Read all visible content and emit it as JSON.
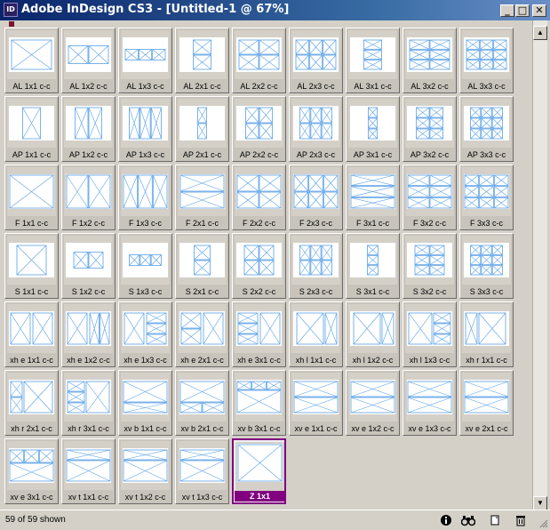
{
  "window": {
    "title": "Adobe InDesign CS3 - [Untitled-1 @ 67%]",
    "app_icon_text": "ID",
    "minimize": "_",
    "maximize": "□",
    "close": "✕"
  },
  "library": {
    "items": [
      {
        "label": "AL 1x1 c-c",
        "kind": "L1x1"
      },
      {
        "label": "AL 1x2 c-c",
        "kind": "L1x2"
      },
      {
        "label": "AL 1x3 c-c",
        "kind": "L1x3"
      },
      {
        "label": "AL 2x1 c-c",
        "kind": "L2x1"
      },
      {
        "label": "AL 2x2 c-c",
        "kind": "L2x2"
      },
      {
        "label": "AL 2x3 c-c",
        "kind": "L2x3"
      },
      {
        "label": "AL 3x1 c-c",
        "kind": "L3x1"
      },
      {
        "label": "AL 3x2 c-c",
        "kind": "L3x2"
      },
      {
        "label": "AL 3x3 c-c",
        "kind": "L3x3"
      },
      {
        "label": "AP 1x1 c-c",
        "kind": "P1x1"
      },
      {
        "label": "AP 1x2 c-c",
        "kind": "P1x2"
      },
      {
        "label": "AP 1x3 c-c",
        "kind": "P1x3"
      },
      {
        "label": "AP 2x1 c-c",
        "kind": "P2x1"
      },
      {
        "label": "AP 2x2 c-c",
        "kind": "P2x2"
      },
      {
        "label": "AP 2x3 c-c",
        "kind": "P2x3"
      },
      {
        "label": "AP 3x1 c-c",
        "kind": "P3x1"
      },
      {
        "label": "AP 3x2 c-c",
        "kind": "P3x2"
      },
      {
        "label": "AP 3x3 c-c",
        "kind": "P3x3"
      },
      {
        "label": "F 1x1 c-c",
        "kind": "F1x1"
      },
      {
        "label": "F 1x2 c-c",
        "kind": "F1x2"
      },
      {
        "label": "F 1x3 c-c",
        "kind": "F1x3"
      },
      {
        "label": "F 2x1 c-c",
        "kind": "F2x1"
      },
      {
        "label": "F 2x2 c-c",
        "kind": "F2x2"
      },
      {
        "label": "F 2x3 c-c",
        "kind": "F2x3"
      },
      {
        "label": "F 3x1 c-c",
        "kind": "F3x1"
      },
      {
        "label": "F 3x2 c-c",
        "kind": "F3x2"
      },
      {
        "label": "F 3x3 c-c",
        "kind": "F3x3"
      },
      {
        "label": "S 1x1 c-c",
        "kind": "S1x1"
      },
      {
        "label": "S 1x2 c-c",
        "kind": "S1x2"
      },
      {
        "label": "S 1x3 c-c",
        "kind": "S1x3"
      },
      {
        "label": "S 2x1 c-c",
        "kind": "S2x1"
      },
      {
        "label": "S 2x2 c-c",
        "kind": "S2x2"
      },
      {
        "label": "S 2x3 c-c",
        "kind": "S2x3"
      },
      {
        "label": "S 3x1 c-c",
        "kind": "S3x1"
      },
      {
        "label": "S 3x2 c-c",
        "kind": "S3x2"
      },
      {
        "label": "S 3x3 c-c",
        "kind": "S3x3"
      },
      {
        "label": "xh e 1x1 c-c",
        "kind": "XE11"
      },
      {
        "label": "xh e 1x2 c-c",
        "kind": "XE12"
      },
      {
        "label": "xh e 1x3 c-c",
        "kind": "XE13"
      },
      {
        "label": "xh e 2x1 c-c",
        "kind": "XE21"
      },
      {
        "label": "xh e 3x1 c-c",
        "kind": "XE31"
      },
      {
        "label": "xh l 1x1 c-c",
        "kind": "XL11"
      },
      {
        "label": "xh l 1x2 c-c",
        "kind": "XL12"
      },
      {
        "label": "xh l 1x3 c-c",
        "kind": "XL13"
      },
      {
        "label": "xh r 1x1 c-c",
        "kind": "XR11"
      },
      {
        "label": "xh r 2x1 c-c",
        "kind": "XR21"
      },
      {
        "label": "xh r 3x1 c-c",
        "kind": "XR31"
      },
      {
        "label": "xv b 1x1 c-c",
        "kind": "VB11"
      },
      {
        "label": "xv b 2x1 c-c",
        "kind": "VB21"
      },
      {
        "label": "xv b 3x1 c-c",
        "kind": "VB31"
      },
      {
        "label": "xv e 1x1 c-c",
        "kind": "VE11"
      },
      {
        "label": "xv e 1x2 c-c",
        "kind": "VE12"
      },
      {
        "label": "xv e 1x3 c-c",
        "kind": "VE13"
      },
      {
        "label": "xv e 2x1 c-c",
        "kind": "VE21"
      },
      {
        "label": "xv e 3x1 c-c",
        "kind": "VE31"
      },
      {
        "label": "xv t 1x1 c-c",
        "kind": "VT11"
      },
      {
        "label": "xv t 1x2 c-c",
        "kind": "VT12"
      },
      {
        "label": "xv t 1x3 c-c",
        "kind": "VT13"
      },
      {
        "label": "Z 1x1",
        "kind": "Z11",
        "selected": true
      }
    ]
  },
  "statusbar": {
    "count_text": "59 of 59 shown",
    "icons": [
      "info-icon",
      "binoculars-icon",
      "new-item-icon",
      "trash-icon"
    ]
  },
  "colors": {
    "frame_line": "#5aa0e6",
    "selected": "#800080",
    "title_bar": "#0a246a"
  }
}
